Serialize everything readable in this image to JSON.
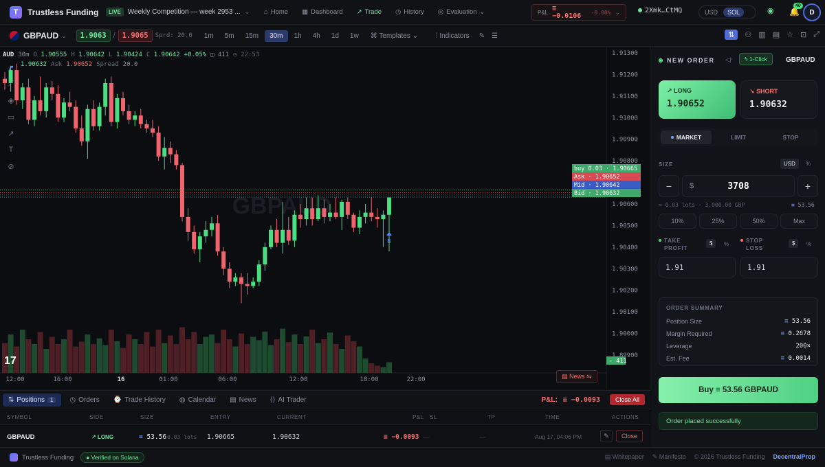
{
  "app": {
    "name": "Trustless Funding",
    "live_badge": "LIVE",
    "competition": "Weekly Competition — week 2953 ..."
  },
  "nav": [
    {
      "label": "Home",
      "icon": "home-icon"
    },
    {
      "label": "Dashboard",
      "icon": "dashboard-icon"
    },
    {
      "label": "Trade",
      "icon": "trade-icon",
      "active": true
    },
    {
      "label": "History",
      "icon": "history-icon"
    },
    {
      "label": "Evaluation",
      "icon": "evaluation-icon"
    }
  ],
  "header": {
    "pnl_label": "P&L",
    "pnl_value": "≡ −0.0106",
    "pnl_pct": "-0.00%",
    "wallet": "2Xmk…CtMQ",
    "cur_usd": "USD",
    "cur_sol": "SOL",
    "notif_count": "40",
    "avatar": "D"
  },
  "toolbar": {
    "symbol": "GBPAUD",
    "bid": "1.9063",
    "sep": "/",
    "ask": "1.9065",
    "spread": "Sprd: 20.0",
    "timeframes": [
      "1m",
      "5m",
      "15m",
      "30m",
      "1h",
      "4h",
      "1d",
      "1w"
    ],
    "active_tf": "30m",
    "templates": "Templates",
    "indicators": "Indicators"
  },
  "chart": {
    "watermark": "GBPAUD",
    "ohlc": {
      "sym": "AUD",
      "tf": "30m",
      "o_l": "O",
      "o": "1.90555",
      "h_l": "H",
      "h": "1.90642",
      "l_l": "L",
      "l": "1.90424",
      "c_l": "C",
      "c": "1.90642",
      "chg": "+0.05%",
      "vol": "411",
      "time": "22:53"
    },
    "bidask": {
      "bid": "1.90632",
      "ask_l": "Ask",
      "ask": "1.90652",
      "spread_l": "Spread",
      "spread": "20.0"
    },
    "price_ticks": [
      "1.91300",
      "1.91200",
      "1.91100",
      "1.91000",
      "1.90900",
      "1.90800",
      "1.90700",
      "1.90600",
      "1.90500",
      "1.90400",
      "1.90300",
      "1.90200",
      "1.90100",
      "1.90000",
      "1.89900"
    ],
    "time_ticks": [
      "12:00",
      "16:00",
      "16",
      "01:00",
      "06:00",
      "12:00",
      "18:00",
      "22:00"
    ],
    "markers": [
      {
        "text": "buy 0.03 · 1.90665",
        "color": "#3fa86a"
      },
      {
        "text": "Ask · 1.90652",
        "color": "#d94a52"
      },
      {
        "text": "Mid · 1.90642",
        "color": "#3b5bc4"
      },
      {
        "text": "Bid · 1.90632",
        "color": "#3fa86a"
      }
    ],
    "vol_tag": "411",
    "news_btn": "News",
    "buy_marker": "B",
    "candles": [
      [
        1.9118,
        1.9121,
        1.9113,
        1.9116
      ],
      [
        1.9116,
        1.9124,
        1.9112,
        1.9122
      ],
      [
        1.9122,
        1.9125,
        1.9106,
        1.9108
      ],
      [
        1.9108,
        1.9116,
        1.9104,
        1.9114
      ],
      [
        1.9114,
        1.9118,
        1.9097,
        1.9099
      ],
      [
        1.9099,
        1.911,
        1.9096,
        1.9108
      ],
      [
        1.9108,
        1.9119,
        1.9101,
        1.9103
      ],
      [
        1.9103,
        1.9116,
        1.91,
        1.9114
      ],
      [
        1.9114,
        1.9117,
        1.9108,
        1.9111
      ],
      [
        1.9111,
        1.9115,
        1.9098,
        1.91
      ],
      [
        1.91,
        1.9109,
        1.9098,
        1.9107
      ],
      [
        1.9107,
        1.9112,
        1.9103,
        1.9105
      ],
      [
        1.9105,
        1.9108,
        1.9093,
        1.9095
      ],
      [
        1.9095,
        1.9101,
        1.9087,
        1.9089
      ],
      [
        1.9089,
        1.9106,
        1.9081,
        1.9104
      ],
      [
        1.9104,
        1.9108,
        1.9094,
        1.9096
      ],
      [
        1.9096,
        1.9107,
        1.9094,
        1.9105
      ],
      [
        1.9105,
        1.9118,
        1.9101,
        1.9116
      ],
      [
        1.9116,
        1.9119,
        1.9096,
        1.9098
      ],
      [
        1.9098,
        1.9111,
        1.9095,
        1.9109
      ],
      [
        1.9109,
        1.9112,
        1.9101,
        1.9103
      ],
      [
        1.9103,
        1.9106,
        1.9097,
        1.9099
      ],
      [
        1.9099,
        1.9103,
        1.9096,
        1.9101
      ],
      [
        1.9101,
        1.9104,
        1.9095,
        1.9097
      ],
      [
        1.9097,
        1.9099,
        1.9093,
        1.9095
      ],
      [
        1.9095,
        1.9099,
        1.9091,
        1.9093
      ],
      [
        1.9093,
        1.9096,
        1.908,
        1.9082
      ],
      [
        1.9082,
        1.9091,
        1.9076,
        1.9086
      ],
      [
        1.9086,
        1.9089,
        1.9079,
        1.9083
      ],
      [
        1.9083,
        1.9085,
        1.9076,
        1.9078
      ],
      [
        1.9078,
        1.9079,
        1.9052,
        1.9054
      ],
      [
        1.9054,
        1.9058,
        1.9043,
        1.9047
      ],
      [
        1.9047,
        1.905,
        1.9037,
        1.9039
      ],
      [
        1.9039,
        1.9047,
        1.9033,
        1.9045
      ],
      [
        1.9045,
        1.9052,
        1.9042,
        1.9048
      ],
      [
        1.9048,
        1.9054,
        1.9045,
        1.9051
      ],
      [
        1.9051,
        1.9055,
        1.9036,
        1.9038
      ],
      [
        1.9038,
        1.904,
        1.9027,
        1.903
      ],
      [
        1.903,
        1.9033,
        1.9021,
        1.9024
      ],
      [
        1.9024,
        1.9028,
        1.9022,
        1.9026
      ],
      [
        1.9026,
        1.9028,
        1.9014,
        1.9023
      ],
      [
        1.9023,
        1.9028,
        1.9018,
        1.9022
      ],
      [
        1.9022,
        1.9026,
        1.9021,
        1.9024
      ],
      [
        1.9024,
        1.9034,
        1.9022,
        1.9032
      ],
      [
        1.9032,
        1.9042,
        1.9029,
        1.904
      ],
      [
        1.904,
        1.905,
        1.9039,
        1.9048
      ],
      [
        1.9048,
        1.9053,
        1.904,
        1.9042
      ],
      [
        1.9042,
        1.9061,
        1.9037,
        1.9048
      ],
      [
        1.9048,
        1.9054,
        1.9041,
        1.9043
      ],
      [
        1.9043,
        1.9057,
        1.904,
        1.9055
      ],
      [
        1.9055,
        1.906,
        1.9049,
        1.9053
      ],
      [
        1.9053,
        1.9063,
        1.905,
        1.9058
      ],
      [
        1.9058,
        1.9063,
        1.905,
        1.9053
      ],
      [
        1.9053,
        1.9064,
        1.9052,
        1.9058
      ],
      [
        1.9058,
        1.9062,
        1.9051,
        1.9054
      ],
      [
        1.9054,
        1.906,
        1.9052,
        1.9056
      ],
      [
        1.9056,
        1.9063,
        1.9053,
        1.9054
      ],
      [
        1.9054,
        1.9062,
        1.9048,
        1.9061
      ],
      [
        1.9061,
        1.9063,
        1.9053,
        1.9055
      ],
      [
        1.9055,
        1.9056,
        1.9047,
        1.9049
      ],
      [
        1.9049,
        1.9057,
        1.9046,
        1.9054
      ],
      [
        1.9054,
        1.906,
        1.9051,
        1.9056
      ],
      [
        1.9056,
        1.9063,
        1.9052,
        1.9054
      ],
      [
        1.9054,
        1.9058,
        1.9049,
        1.9053
      ],
      [
        1.9053,
        1.9057,
        1.904,
        1.9055
      ],
      [
        1.9055,
        1.9063,
        1.9038,
        1.9063
      ]
    ],
    "volumes": [
      0.62,
      0.8,
      0.55,
      0.9,
      0.7,
      0.6,
      0.85,
      0.5,
      0.75,
      0.6,
      0.7,
      0.9,
      0.55,
      0.65,
      0.8,
      0.6,
      0.72,
      0.58,
      0.9,
      0.66,
      0.52,
      0.8,
      0.7,
      0.6,
      0.85,
      0.55,
      0.9,
      0.62,
      0.78,
      0.6,
      0.95,
      0.7,
      0.85,
      0.6,
      0.75,
      0.8,
      0.62,
      0.9,
      0.7,
      0.55,
      0.82,
      0.6,
      0.75,
      0.68,
      0.86,
      0.58,
      0.7,
      0.92,
      0.64,
      0.8,
      0.6,
      0.76,
      0.9,
      0.62,
      0.7,
      0.84,
      0.6,
      0.5,
      0.78,
      0.66,
      0.55,
      0.3,
      0.2,
      0.15,
      0.12,
      0.22
    ]
  },
  "bottom_tabs": {
    "positions": "Positions",
    "positions_count": "1",
    "orders": "Orders",
    "history": "Trade History",
    "calendar": "Calendar",
    "news": "News",
    "ai": "AI Trader",
    "pnl_label": "P&L:",
    "pnl_value": "≡ −0.0093",
    "close_all": "Close All"
  },
  "positions_head": [
    "SYMBOL",
    "SIDE",
    "SIZE",
    "ENTRY",
    "CURRENT",
    "P&L",
    "SL",
    "TP",
    "TIME",
    "ACTIONS"
  ],
  "position": {
    "symbol": "GBPAUD",
    "side": "↗ LONG",
    "size": "53.56",
    "lots": "0.03 lots",
    "entry": "1.90665",
    "current": "1.90632",
    "pnl": "≡ −0.0093",
    "sl": "—",
    "tp": "—",
    "time": "Aug 17, 04:06 PM",
    "close": "Close"
  },
  "panel": {
    "title": "NEW ORDER",
    "one_click": "1-Click",
    "symbol": "GBPAUD",
    "long_label": "LONG",
    "long_price": "1.90652",
    "short_label": "SHORT",
    "short_price": "1.90632",
    "types": [
      "MARKET",
      "LIMIT",
      "STOP"
    ],
    "size_label": "SIZE",
    "size_usd": "USD",
    "size_pct": "%",
    "dollar": "$",
    "size_value": "3708",
    "minus": "−",
    "plus": "+",
    "size_note": "≈ 0.03 lots · 3,000.00 GBP",
    "size_sol": "53.56",
    "pcts": [
      "10%",
      "25%",
      "50%",
      "Max"
    ],
    "tp_label": "TAKE PROFIT",
    "sl_label": "STOP LOSS",
    "tp_value": "1.91",
    "sl_value": "1.91",
    "summary_title": "ORDER SUMMARY",
    "summary": [
      {
        "k": "Position Size",
        "v": "53.56",
        "sol": true
      },
      {
        "k": "Margin Required",
        "v": "0.2678",
        "sol": true
      },
      {
        "k": "Leverage",
        "v": "200×",
        "sol": false
      },
      {
        "k": "Est. Fee",
        "v": "0.0014",
        "sol": true
      }
    ],
    "buy_btn": "Buy ≡ 53.56 GBPAUD",
    "toast": "Order placed successfully"
  },
  "footer": {
    "brand": "Trustless Funding",
    "verified": "Verified on Solana",
    "whitepaper": "Whitepaper",
    "manifesto": "Manifesto",
    "copyright": "© 2026 Trustless Funding",
    "partner": "DecentralProp"
  }
}
